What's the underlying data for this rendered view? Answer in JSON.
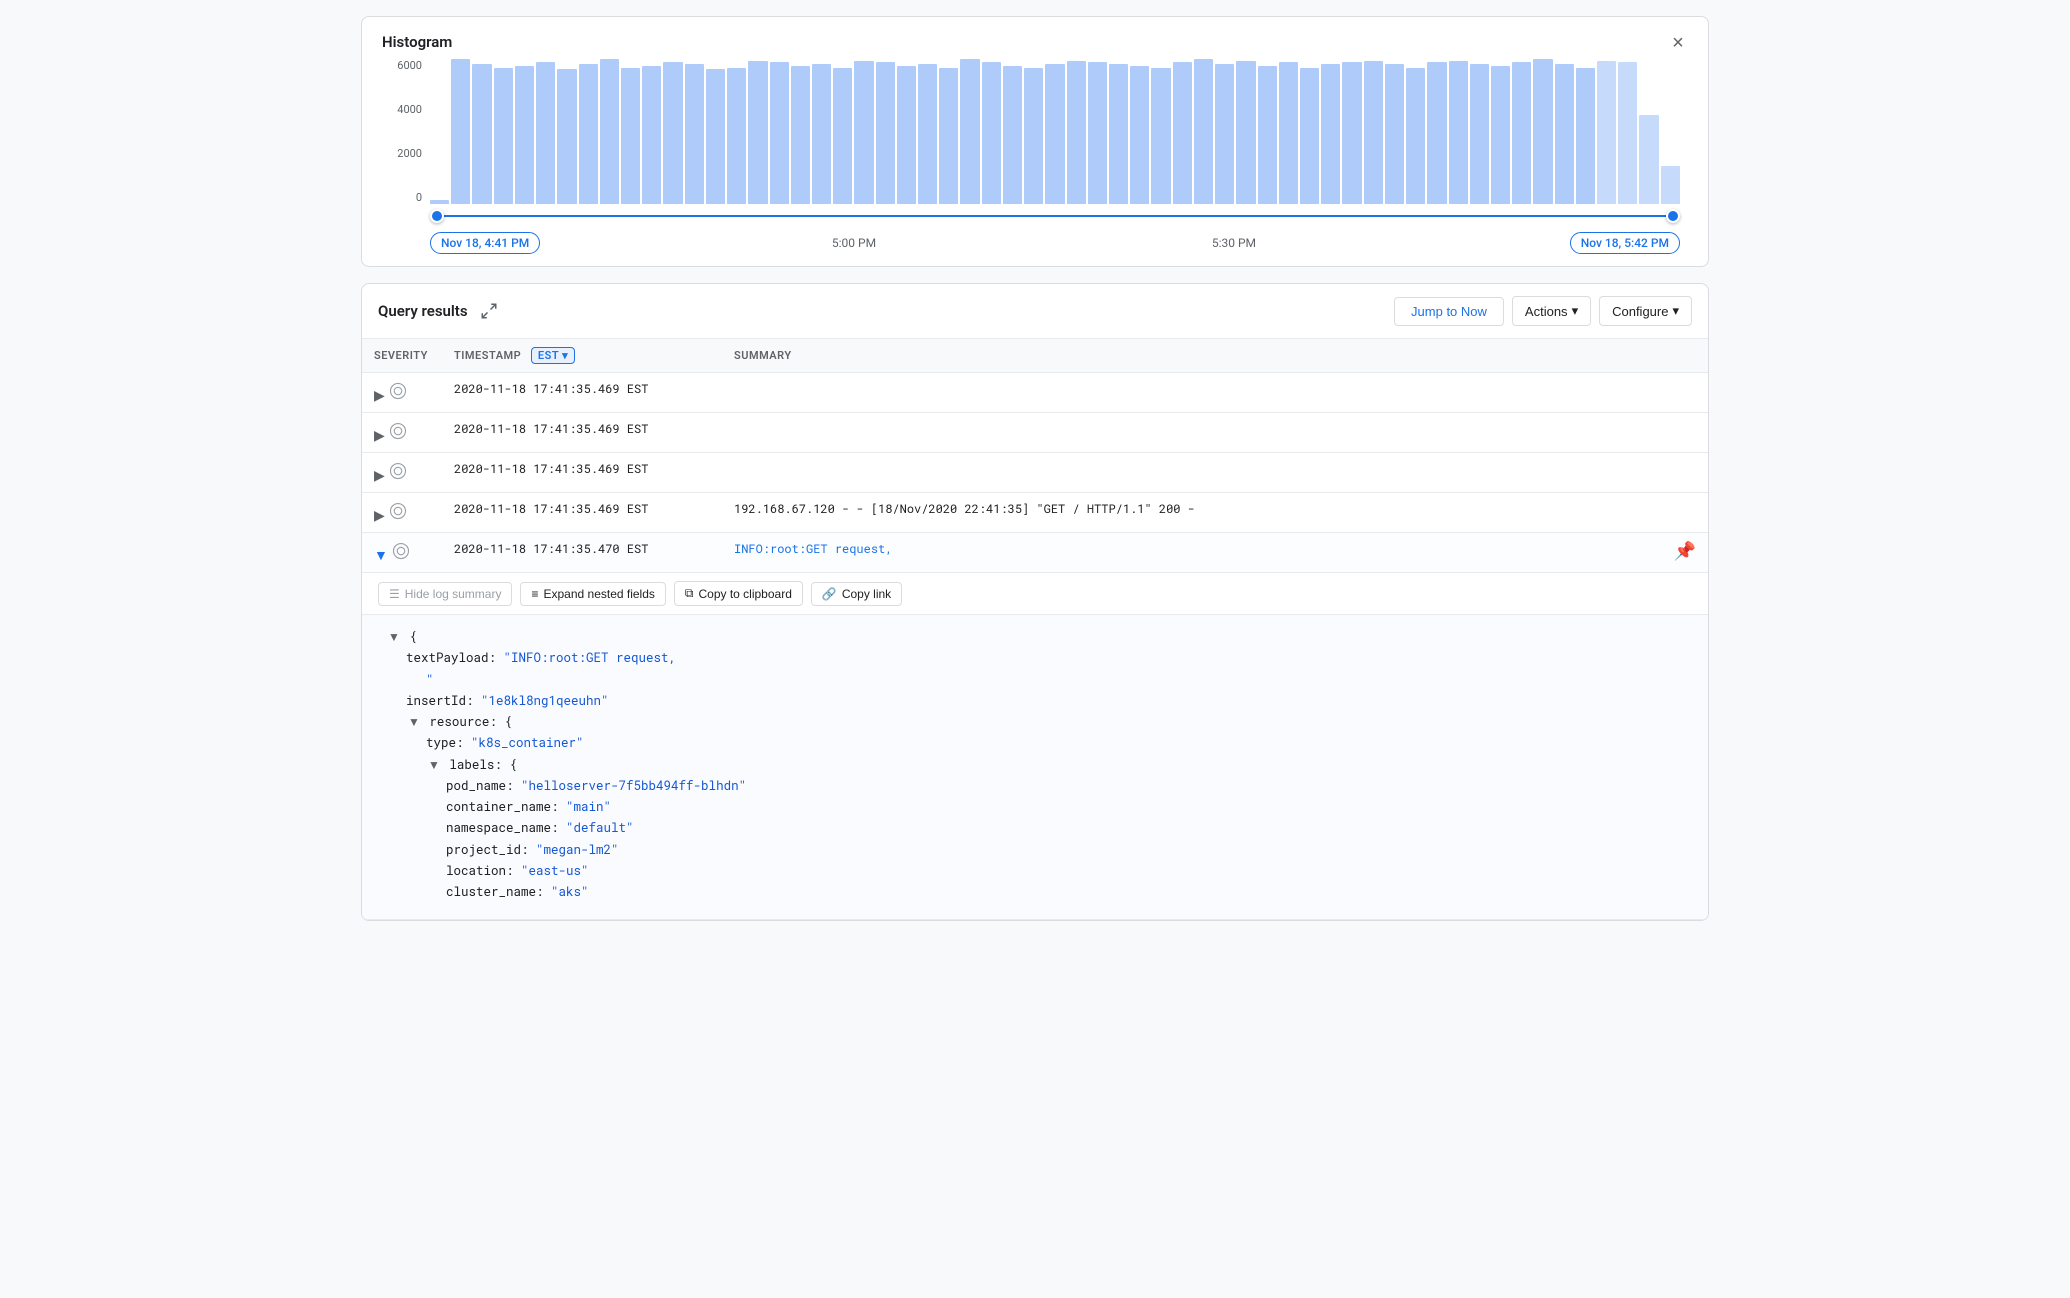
{
  "histogram": {
    "title": "Histogram",
    "close_label": "×",
    "y_axis_labels": [
      "0",
      "2000",
      "4000",
      "6000"
    ],
    "time_labels": {
      "left": "Nov 18, 4:41 PM",
      "center": "5:00 PM",
      "right_center": "5:30 PM",
      "right": "Nov 18, 5:42 PM"
    },
    "bars": [
      2,
      85,
      82,
      80,
      81,
      83,
      79,
      82,
      85,
      80,
      81,
      83,
      82,
      79,
      80,
      84,
      83,
      81,
      82,
      80,
      84,
      83,
      81,
      82,
      80,
      85,
      83,
      81,
      80,
      82,
      84,
      83,
      82,
      81,
      80,
      83,
      85,
      82,
      84,
      81,
      83,
      80,
      82,
      83,
      84,
      82,
      80,
      83,
      84,
      82,
      81,
      83,
      85,
      82,
      80,
      84,
      83,
      52,
      22
    ]
  },
  "query_results": {
    "title": "Query results",
    "expand_icon": "⤢",
    "jump_to_now": "Jump to Now",
    "actions": "Actions",
    "configure": "Configure",
    "columns": {
      "severity": "SEVERITY",
      "timestamp": "TIMESTAMP",
      "timezone": "EST",
      "summary": "SUMMARY"
    },
    "rows": [
      {
        "id": 1,
        "expanded": false,
        "timestamp": "2020-11-18 17:41:35.469 EST",
        "summary": ""
      },
      {
        "id": 2,
        "expanded": false,
        "timestamp": "2020-11-18 17:41:35.469 EST",
        "summary": ""
      },
      {
        "id": 3,
        "expanded": false,
        "timestamp": "2020-11-18 17:41:35.469 EST",
        "summary": ""
      },
      {
        "id": 4,
        "expanded": false,
        "timestamp": "2020-11-18 17:41:35.469 EST",
        "summary": "192.168.67.120 - - [18/Nov/2020 22:41:35] \"GET / HTTP/1.1\" 200 -"
      },
      {
        "id": 5,
        "expanded": true,
        "timestamp": "2020-11-18 17:41:35.470 EST",
        "summary": "INFO:root:GET request,"
      }
    ],
    "expanded_detail": {
      "hide_log_summary_label": "Hide log summary",
      "expand_nested_label": "Expand nested fields",
      "copy_to_clipboard_label": "Copy to clipboard",
      "copy_link_label": "Copy link",
      "content": {
        "text_payload_key": "textPayload:",
        "text_payload_val": "\"INFO:root:GET request,",
        "text_payload_val2": "\"",
        "insert_id_key": "insertId:",
        "insert_id_val": "\"1e8kl8ng1qeeuhn\"",
        "resource_key": "resource:",
        "type_key": "type:",
        "type_val": "\"k8s_container\"",
        "labels_key": "labels:",
        "pod_name_key": "pod_name:",
        "pod_name_val": "\"helloserver-7f5bb494ff-blhdn\"",
        "container_name_key": "container_name:",
        "container_name_val": "\"main\"",
        "namespace_name_key": "namespace_name:",
        "namespace_name_val": "\"default\"",
        "project_id_key": "project_id:",
        "project_id_val": "\"megan-lm2\"",
        "location_key": "location:",
        "location_val": "\"east-us\"",
        "cluster_name_key": "cluster_name:",
        "cluster_name_val": "\"aks\""
      }
    }
  }
}
